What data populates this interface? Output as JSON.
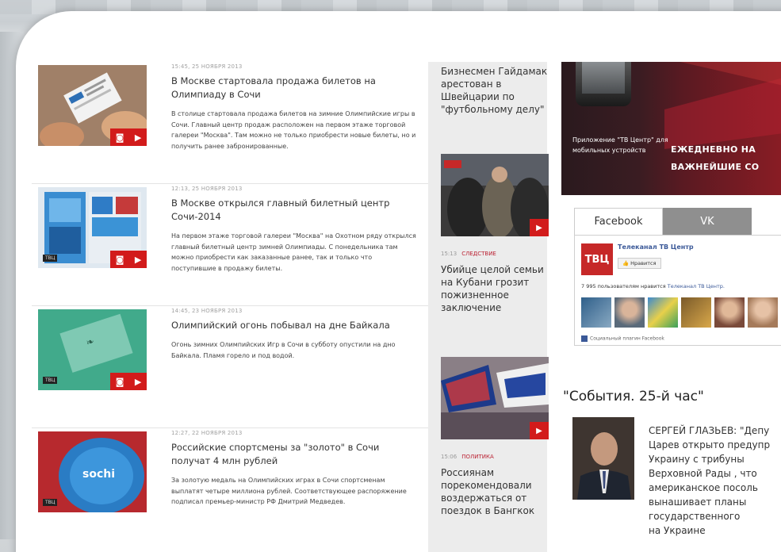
{
  "news": [
    {
      "date": "15:45, 25 НОЯБРЯ 2013",
      "title": "В Москве стартовала продажа билетов на Олимпиаду в Сочи",
      "text": "В столице стартовала продажа билетов на зимние Олимпийские игры в Сочи. Главный центр продаж расположен на первом этаже торговой галереи \"Москва\". Там можно не только приобрести новые билеты, но и получить ранее забронированные."
    },
    {
      "date": "12:13, 25 НОЯБРЯ 2013",
      "title": "В Москве открылся главный билетный центр Сочи-2014",
      "text": "На первом этаже торговой галереи \"Москва\" на Охотном ряду открылся главный билетный центр зимней Олимпиады. С понедельника там можно приобрести как заказанные ранее, так и только что поступившие в продажу билеты."
    },
    {
      "date": "14:45, 23 НОЯБРЯ 2013",
      "title": "Олимпийский огонь побывал на дне Байкала",
      "text": "Огонь зимних Олимпийских Игр в Сочи в субботу опустили на дно Байкала. Пламя горело и под водой."
    },
    {
      "date": "12:27, 22 НОЯБРЯ 2013",
      "title": "Российские спортсмены за \"золото\" в Сочи получат 4 млн рублей",
      "text": "За золотую медаль на Олимпийских играх в Сочи спортсменам выплатят четыре миллиона рублей. Соответствующее распоряжение подписал премьер-министр РФ Дмитрий Медведев."
    }
  ],
  "mid": [
    {
      "title": "Бизнесмен Гайдамак арестован в Швейцарии по \"футбольному делу\""
    },
    {
      "time": "15:13",
      "category": "СЛЕДСТВИЕ",
      "title": "Убийце целой семьи на Кубани грозит пожизненное заключение"
    },
    {
      "time": "15:06",
      "category": "ПОЛИТИКА",
      "title": "Россиянам порекомендовали воздержаться от поездок в Бангкок"
    }
  ],
  "banner": {
    "app_text": "Приложение \"ТВ Центр\" для мобильных устройств",
    "slogan_1": "ЕЖЕДНЕВНО НА",
    "slogan_2": "ВАЖНЕЙШИЕ СО"
  },
  "social": {
    "tab_facebook": "Facebook",
    "tab_vk": "VK",
    "page_name": "Телеканал ТВ Центр",
    "logo_text": "ТВЦ",
    "like_label": "Нравится",
    "count_text": "7 995 пользователям нравится ",
    "count_link": "Телеканал ТВ Центр.",
    "footer": "Социальный плагин Facebook"
  },
  "sobytiya": {
    "title": "\"События. 25-й час\"",
    "lines": [
      "СЕРГЕЙ ГЛАЗЬЕВ: \"Депу",
      "Царев открыто предупр",
      "Украину с трибуны",
      "Верховной Рады , что",
      "американское посоль",
      "вынашивает планы",
      "государственного",
      "на Украине"
    ]
  },
  "colors": {
    "accent": "#d21b1b",
    "facebook": "#3b5998"
  }
}
